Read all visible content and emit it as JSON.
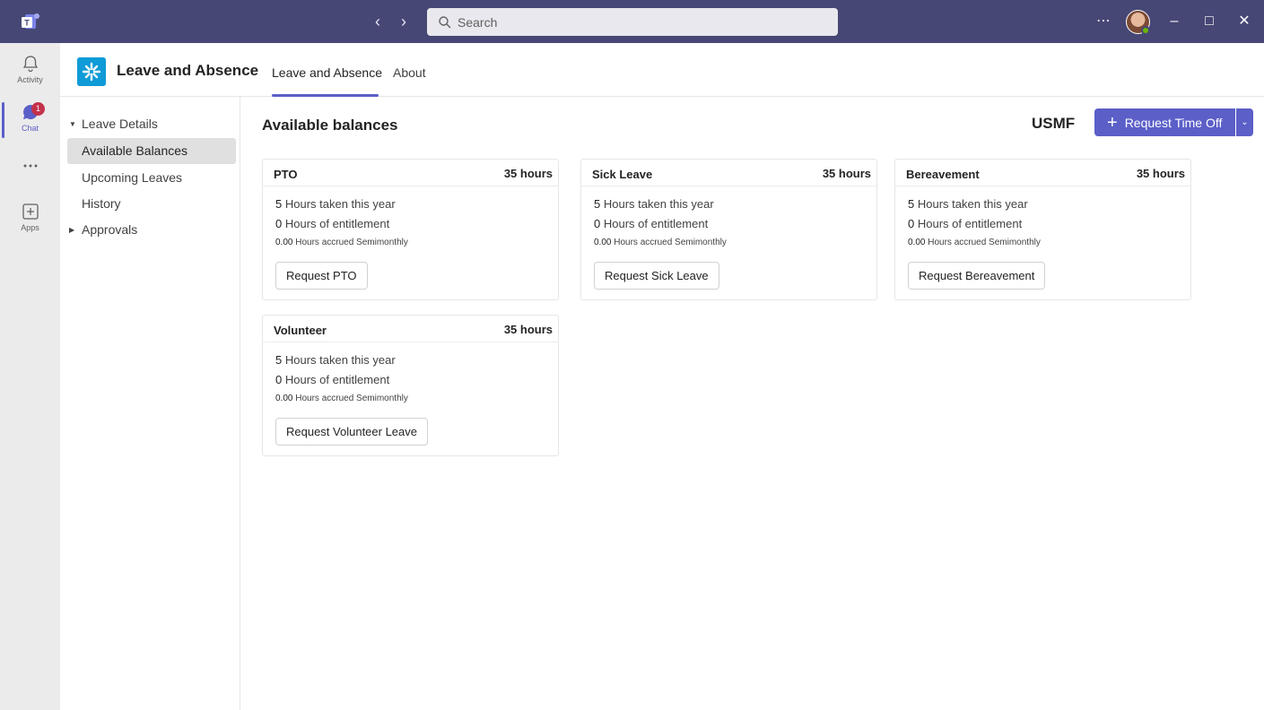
{
  "titlebar": {
    "search_placeholder": "Search",
    "back_icon": "chevron-left-icon",
    "forward_icon": "chevron-right-icon",
    "more_icon": "ellipsis-icon",
    "accent": "#464775"
  },
  "rail": {
    "items": [
      {
        "label": "Activity",
        "icon": "bell-icon"
      },
      {
        "label": "Chat",
        "icon": "chat-icon",
        "badge": "1"
      },
      {
        "label": "",
        "icon": "more-apps-icon"
      },
      {
        "label": "Apps",
        "icon": "apps-icon"
      }
    ]
  },
  "app": {
    "title": "Leave and Absence",
    "tabs": [
      {
        "label": "Leave and Absence",
        "active": true
      },
      {
        "label": "About",
        "active": false
      }
    ]
  },
  "leftnav": {
    "items": [
      {
        "label": "Leave Details",
        "type": "group-expanded"
      },
      {
        "label": "Available Balances",
        "type": "item",
        "selected": true
      },
      {
        "label": "Upcoming Leaves",
        "type": "item"
      },
      {
        "label": "History",
        "type": "item"
      },
      {
        "label": "Approvals",
        "type": "group-collapsed"
      }
    ]
  },
  "main": {
    "title": "Available balances",
    "company": "USMF",
    "request_button": "Request Time Off",
    "primary_color": "#5b5fc7",
    "cards": [
      {
        "name": "PTO",
        "hours": "35 hours",
        "taken_num": "5",
        "taken_text": "Hours taken this year",
        "entitle_num": "0",
        "entitle_text": "Hours of entitlement",
        "accrued_num": "0.00",
        "accrued_text": "Hours accrued Semimonthly",
        "button": "Request PTO"
      },
      {
        "name": "Sick Leave",
        "hours": "35 hours",
        "taken_num": "5",
        "taken_text": "Hours taken this year",
        "entitle_num": "0",
        "entitle_text": "Hours of entitlement",
        "accrued_num": "0.00",
        "accrued_text": "Hours accrued Semimonthly",
        "button": "Request Sick Leave"
      },
      {
        "name": "Bereavement",
        "hours": "35 hours",
        "taken_num": "5",
        "taken_text": "Hours taken this year",
        "entitle_num": "0",
        "entitle_text": "Hours of entitlement",
        "accrued_num": "0.00",
        "accrued_text": "Hours accrued Semimonthly",
        "button": "Request Bereavement"
      },
      {
        "name": "Volunteer",
        "hours": "35 hours",
        "taken_num": "5",
        "taken_text": "Hours taken this year",
        "entitle_num": "0",
        "entitle_text": "Hours of entitlement",
        "accrued_num": "0.00",
        "accrued_text": "Hours accrued Semimonthly",
        "button": "Request Volunteer Leave"
      }
    ]
  }
}
